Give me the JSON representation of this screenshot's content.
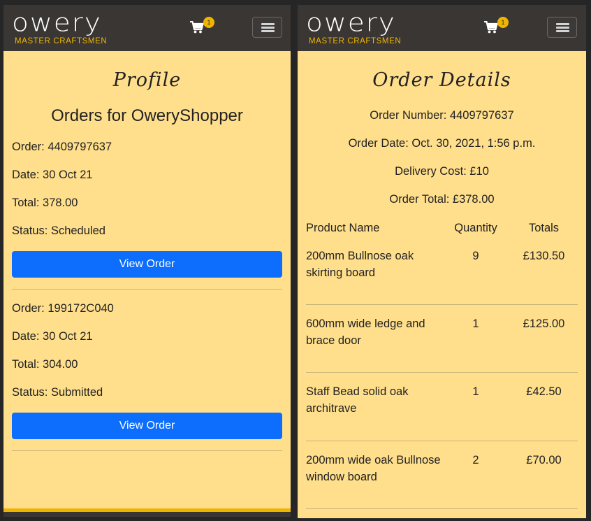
{
  "brand": {
    "wordmark": "owery",
    "tagline": "MASTER CRAFTSMEN",
    "accent": "#f0b500",
    "nav_bg": "#393634",
    "page_bg": "#ffdf8c",
    "button_color": "#0d6efd"
  },
  "cart": {
    "count": "1"
  },
  "profile": {
    "heading": "Profile",
    "orders_title": "Orders for OweryShopper",
    "orders": [
      {
        "order": "Order: 4409797637",
        "date": "Date: 30 Oct 21",
        "total": "Total: 378.00",
        "status": "Status: Scheduled",
        "button": "View Order"
      },
      {
        "order": "Order: 199172C040",
        "date": "Date: 30 Oct 21",
        "total": "Total: 304.00",
        "status": "Status: Submitted",
        "button": "View Order"
      }
    ]
  },
  "order_details": {
    "heading": "Order Details",
    "order_number": "Order Number: 4409797637",
    "order_date": "Order Date: Oct. 30, 2021, 1:56 p.m.",
    "delivery_cost": "Delivery Cost: £10",
    "order_total": "Order Total: £378.00",
    "columns": [
      "Product Name",
      "Quantity",
      "Totals"
    ],
    "items": [
      {
        "name": "200mm Bullnose oak skirting board",
        "quantity": "9",
        "total": "£130.50"
      },
      {
        "name": "600mm wide ledge and brace door",
        "quantity": "1",
        "total": "£125.00"
      },
      {
        "name": "Staff Bead solid oak architrave",
        "quantity": "1",
        "total": "£42.50"
      },
      {
        "name": "200mm wide oak Bullnose window board",
        "quantity": "2",
        "total": "£70.00"
      }
    ]
  }
}
